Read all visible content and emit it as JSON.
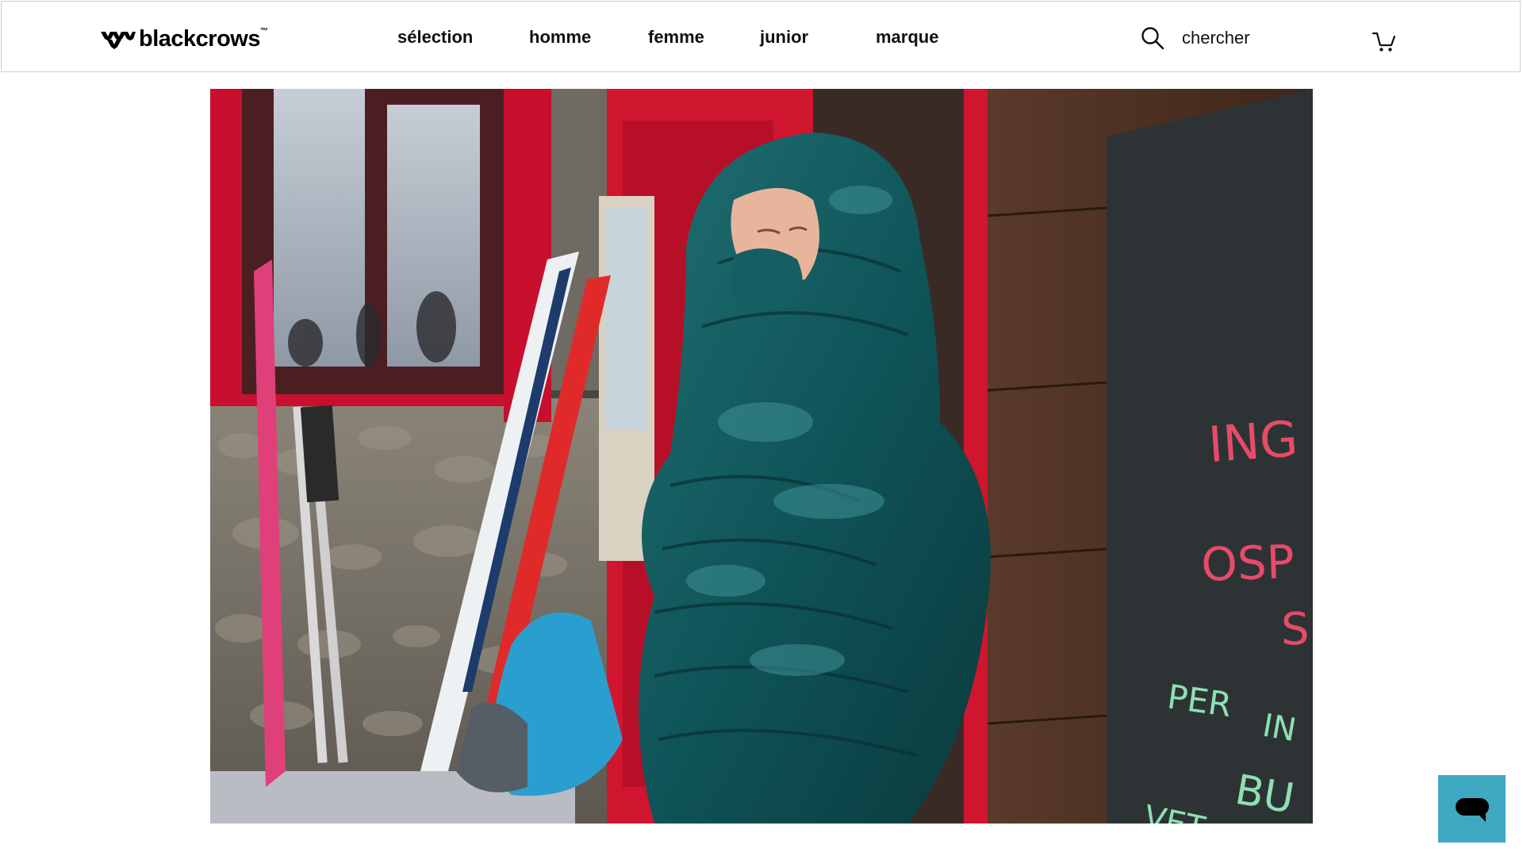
{
  "header": {
    "logo_text": "blackcrows",
    "logo_tm": "™",
    "nav": [
      {
        "label": "sélection"
      },
      {
        "label": "homme"
      },
      {
        "label": "femme"
      },
      {
        "label": "junior"
      },
      {
        "label": "marque"
      }
    ],
    "search": {
      "placeholder": "chercher",
      "icon": "search-icon"
    },
    "cart_icon": "cart-icon"
  },
  "hero": {
    "chalkboard_lines": [
      "ING",
      "OSP",
      "S",
      "PER",
      "IN",
      "BU",
      "VET"
    ]
  },
  "chat": {
    "icon": "chat-bubble-icon",
    "color": "#3fa8c2"
  }
}
